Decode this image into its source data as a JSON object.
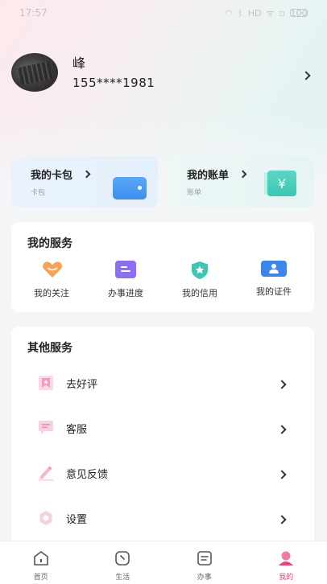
{
  "status_bar": {
    "time": "17:57",
    "icons": [
      "wifi-icon",
      "bluetooth-icon",
      "hd-icon",
      "signal-icon",
      "sim-icon"
    ],
    "battery": "100"
  },
  "profile": {
    "name": "峰",
    "phone": "155****1981"
  },
  "quick_cards": [
    {
      "title": "我的卡包",
      "subtitle": "卡包",
      "icon": "wallet-icon",
      "color": "#4a9cf3"
    },
    {
      "title": "我的账单",
      "subtitle": "账单",
      "icon": "yuan-bill-icon",
      "glyph": "¥",
      "color": "#45c9b7"
    }
  ],
  "my_services": {
    "title": "我的服务",
    "items": [
      {
        "label": "我的关注",
        "icon": "heart-icon",
        "color": "#f6a25a"
      },
      {
        "label": "办事进度",
        "icon": "progress-list-icon",
        "color": "#8d6df0"
      },
      {
        "label": "我的信用",
        "icon": "star-shield-icon",
        "color": "#3ec6b4"
      },
      {
        "label": "我的证件",
        "icon": "id-card-icon",
        "color": "#3b86e8"
      }
    ]
  },
  "other_services": {
    "title": "其他服务",
    "items": [
      {
        "label": "去好评",
        "icon": "star-bookmark-icon"
      },
      {
        "label": "客服",
        "icon": "chat-bubble-icon"
      },
      {
        "label": "意见反馈",
        "icon": "pen-icon"
      },
      {
        "label": "设置",
        "icon": "gear-icon"
      }
    ]
  },
  "tabbar": {
    "active": "我的",
    "accent": "#e5487a",
    "items": [
      {
        "label": "首页",
        "icon": "home-icon"
      },
      {
        "label": "生活",
        "icon": "life-icon"
      },
      {
        "label": "办事",
        "icon": "tasks-icon"
      },
      {
        "label": "我的",
        "icon": "profile-icon"
      }
    ]
  }
}
